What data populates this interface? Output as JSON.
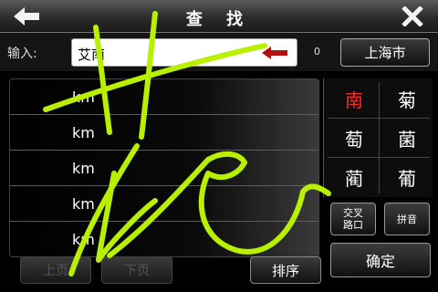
{
  "header": {
    "title": "查 找"
  },
  "input": {
    "label": "输入:",
    "value": "艾南",
    "count": "0"
  },
  "city_button": "上海市",
  "results": [
    {
      "unit": "km"
    },
    {
      "unit": "km"
    },
    {
      "unit": "km"
    },
    {
      "unit": "km"
    },
    {
      "unit": "km"
    }
  ],
  "footer": {
    "prev": "上页",
    "next": "下页",
    "sort": "排序"
  },
  "candidates": [
    {
      "char": "南",
      "color": "#ff2a2a"
    },
    {
      "char": "菊",
      "color": "#ffffff"
    },
    {
      "char": "萄",
      "color": "#ffffff"
    },
    {
      "char": "菌",
      "color": "#ffffff"
    },
    {
      "char": "蔺",
      "color": "#ffffff"
    },
    {
      "char": "葡",
      "color": "#ffffff"
    }
  ],
  "buttons": {
    "cross": "交叉\n路口",
    "pinyin": "拼音",
    "ok": "确定"
  },
  "ink_color": "#b8f000"
}
